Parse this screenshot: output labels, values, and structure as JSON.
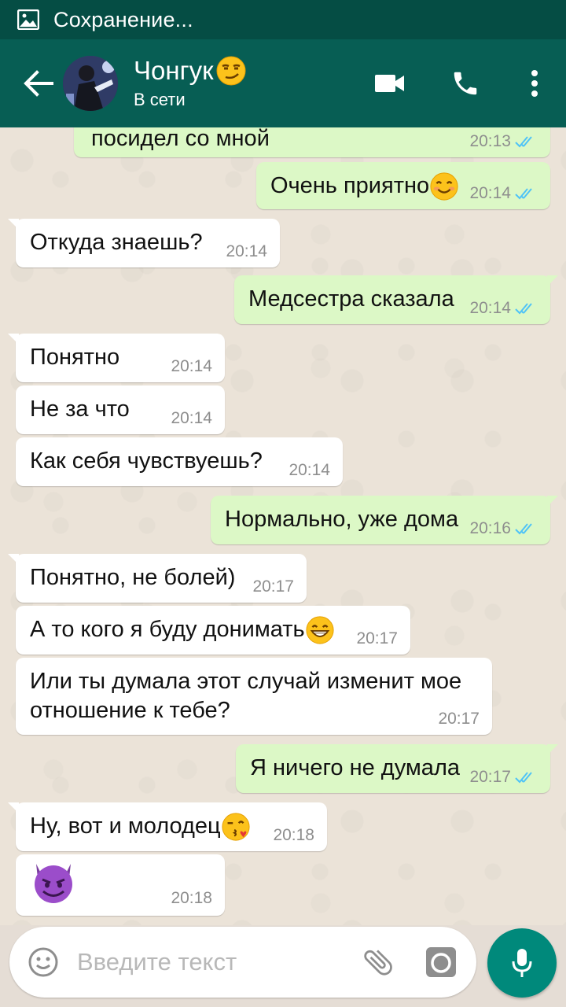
{
  "status_bar": {
    "text": "Сохранение..."
  },
  "header": {
    "name": "Чонгук",
    "status": "В сети"
  },
  "messages": [
    {
      "dir": "out",
      "text": "посидел со мной",
      "time": "20:13"
    },
    {
      "dir": "out",
      "text": "Очень приятно",
      "time": "20:14",
      "emoji": "smile"
    },
    {
      "dir": "in",
      "text": "Откуда знаешь?",
      "time": "20:14"
    },
    {
      "dir": "out",
      "text": "Медсестра сказала",
      "time": "20:14"
    },
    {
      "dir": "in",
      "text": "Понятно",
      "time": "20:14"
    },
    {
      "dir": "in",
      "text": "Не за что",
      "time": "20:14"
    },
    {
      "dir": "in",
      "text": "Как себя чувствуешь?",
      "time": "20:14"
    },
    {
      "dir": "out",
      "text": "Нормально, уже дома",
      "time": "20:16"
    },
    {
      "dir": "in",
      "text": "Понятно, не болей)",
      "time": "20:17"
    },
    {
      "dir": "in",
      "text": "А то кого я буду донимать",
      "time": "20:17",
      "emoji": "grin"
    },
    {
      "dir": "in",
      "text_line1": "Или ты думала этот случай изменит мое",
      "text_line2": "отношение к тебе?",
      "time": "20:17"
    },
    {
      "dir": "out",
      "text": "Я ничего не думала",
      "time": "20:17"
    },
    {
      "dir": "in",
      "text": "Ну, вот и молодец",
      "time": "20:18",
      "emoji": "kiss"
    },
    {
      "dir": "in",
      "text": "",
      "time": "20:18",
      "emoji": "devil"
    }
  ],
  "input": {
    "placeholder": "Введите текст"
  },
  "colors": {
    "header": "#075e54",
    "statusbar": "#054d44",
    "outgoing": "#dcf8c6",
    "incoming": "#ffffff",
    "tick": "#4fc3f7",
    "fab": "#00897b"
  },
  "icons": [
    "image-icon",
    "back-arrow-icon",
    "video-call-icon",
    "phone-icon",
    "more-vert-icon",
    "emoji-icon",
    "attach-icon",
    "camera-icon",
    "mic-icon",
    "double-check-icon"
  ]
}
